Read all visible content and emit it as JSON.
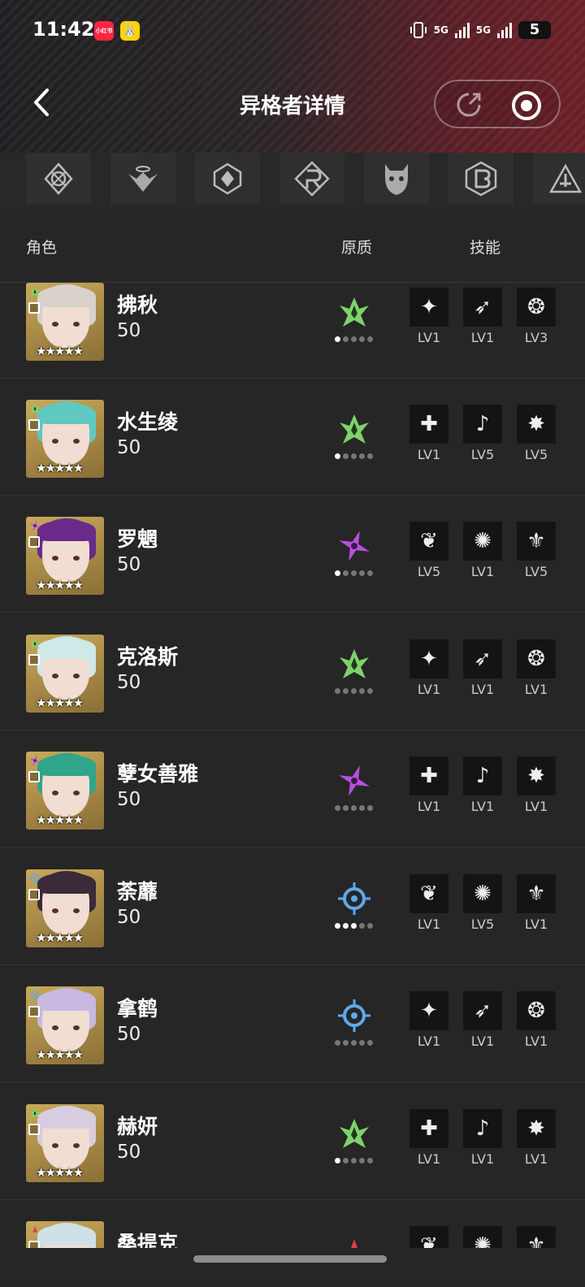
{
  "status_bar": {
    "time": "11:42",
    "app_badge_1": "小红书",
    "net_1": "5G",
    "net_2": "5G",
    "battery": "5"
  },
  "nav": {
    "title": "异格者详情"
  },
  "columns": {
    "role": "角色",
    "quality": "原质",
    "skills": "技能"
  },
  "rows": [
    {
      "name": "拂秋",
      "level": "50",
      "element": "green",
      "dots": 1,
      "skills": [
        "LV1",
        "LV1",
        "LV3"
      ],
      "hair": "#d9d2cc"
    },
    {
      "name": "水生绫",
      "level": "50",
      "element": "green",
      "dots": 1,
      "skills": [
        "LV1",
        "LV5",
        "LV5"
      ],
      "hair": "#5fc8c0"
    },
    {
      "name": "罗魍",
      "level": "50",
      "element": "purple",
      "dots": 1,
      "skills": [
        "LV5",
        "LV1",
        "LV5"
      ],
      "hair": "#6a2a8a"
    },
    {
      "name": "克洛斯",
      "level": "50",
      "element": "green",
      "dots": 0,
      "skills": [
        "LV1",
        "LV1",
        "LV1"
      ],
      "hair": "#cfe8e8"
    },
    {
      "name": "孽女善雅",
      "level": "50",
      "element": "purple",
      "dots": 0,
      "skills": [
        "LV1",
        "LV1",
        "LV1"
      ],
      "hair": "#2fa58a"
    },
    {
      "name": "荼蘼",
      "level": "50",
      "element": "blue",
      "dots": 3,
      "skills": [
        "LV1",
        "LV5",
        "LV1"
      ],
      "hair": "#3a2a3a"
    },
    {
      "name": "拿鹤",
      "level": "50",
      "element": "blue",
      "dots": 0,
      "skills": [
        "LV1",
        "LV1",
        "LV1"
      ],
      "hair": "#c8b8e0"
    },
    {
      "name": "赫妍",
      "level": "50",
      "element": "green",
      "dots": 1,
      "skills": [
        "LV1",
        "LV1",
        "LV1"
      ],
      "hair": "#d8cde0"
    },
    {
      "name": "桑提克",
      "level": "",
      "element": "red",
      "dots": 0,
      "skills": [
        "",
        "",
        ""
      ],
      "hair": "#cfe0e8"
    }
  ],
  "colors": {
    "green": "#7fd36b",
    "purple": "#b94fe0",
    "blue": "#5fa8f0",
    "red": "#e04040"
  }
}
